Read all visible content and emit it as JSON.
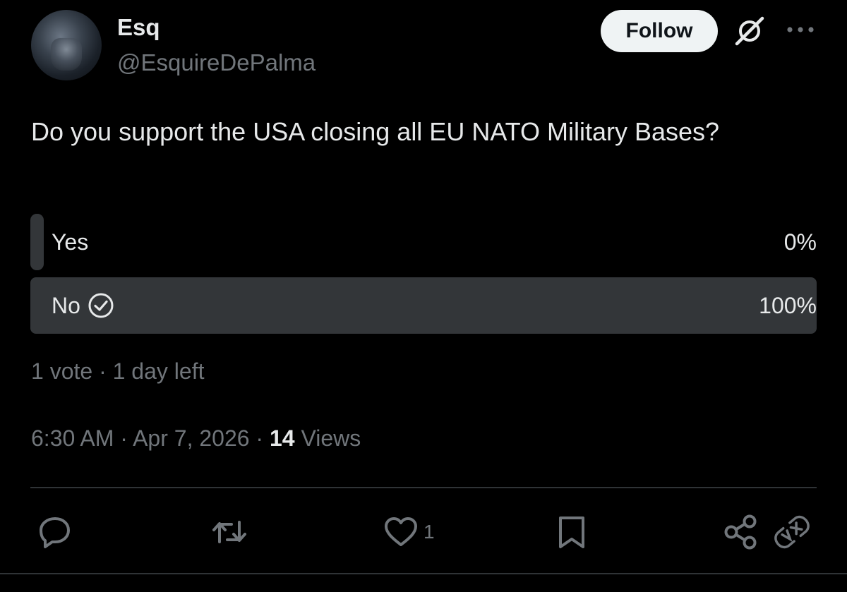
{
  "author": {
    "display_name": "Esq",
    "handle": "@EsquireDePalma"
  },
  "header": {
    "follow_label": "Follow",
    "grok_icon": "grok-slash-icon",
    "more_icon": "more-dots-icon"
  },
  "tweet": {
    "text": "Do you support the USA closing all EU NATO Military Bases?"
  },
  "poll": {
    "options": [
      {
        "label": "Yes",
        "percent_text": "0%",
        "fraction": 0.0,
        "selected": false
      },
      {
        "label": "No",
        "percent_text": "100%",
        "fraction": 1.0,
        "selected": true
      }
    ],
    "meta": "1 vote · 1 day left"
  },
  "timestamp": {
    "time_date": "6:30 AM · Apr 7, 2026 · ",
    "views_count": "14",
    "views_label": " Views"
  },
  "actions": {
    "reply_icon": "reply-icon",
    "repost_icon": "repost-icon",
    "like_icon": "heart-icon",
    "like_count": "1",
    "bookmark_icon": "bookmark-icon",
    "share_icon": "share-icon",
    "vx_icon": "vx-link-icon"
  },
  "colors": {
    "background": "#000000",
    "primary_text": "#e7e9ea",
    "secondary_text": "#71767b",
    "poll_bar": "#333639",
    "follow_button_bg": "#eff3f4"
  }
}
